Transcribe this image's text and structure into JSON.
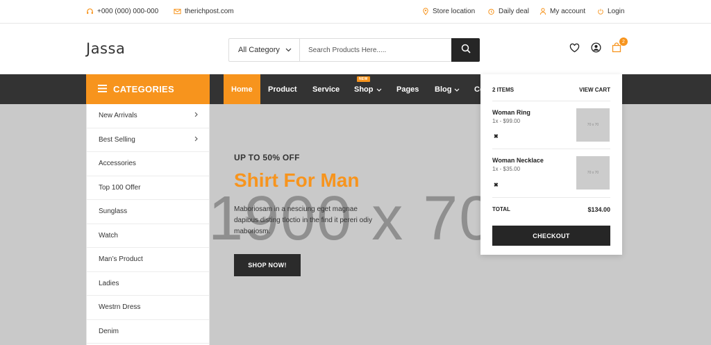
{
  "topbar": {
    "phone": "+000 (000) 000-000",
    "email": "therichpost.com",
    "store_location": "Store location",
    "daily_deal": "Daily deal",
    "my_account": "My account",
    "login": "Login"
  },
  "header": {
    "logo": "Jassa",
    "category_select": "All Category",
    "search_placeholder": "Search Products Here.....",
    "cart_count": "2"
  },
  "nav": {
    "categories_label": "CATEGORIES",
    "items": [
      {
        "label": "Home"
      },
      {
        "label": "Product"
      },
      {
        "label": "Service"
      },
      {
        "label": "Shop",
        "tag": "NEW"
      },
      {
        "label": "Pages"
      },
      {
        "label": "Blog"
      },
      {
        "label": "Co"
      }
    ]
  },
  "categories": [
    {
      "label": "New Arrivals"
    },
    {
      "label": "Best Selling"
    },
    {
      "label": "Accessories"
    },
    {
      "label": "Top 100 Offer"
    },
    {
      "label": "Sunglass"
    },
    {
      "label": "Watch"
    },
    {
      "label": "Man’s Product"
    },
    {
      "label": "Ladies"
    },
    {
      "label": "Westrn Dress"
    },
    {
      "label": "Denim"
    }
  ],
  "hero": {
    "placeholder": "1900 x 700",
    "eyebrow": "UP TO 50% OFF",
    "title": "Shirt For Man",
    "description": "Maboriosam in a nesciung eget magnae dapibus disting tloctio in the find it pereri odiy maboriosm.",
    "cta": "SHOP NOW!"
  },
  "cart": {
    "items_count": "2 ITEMS",
    "view_cart": "VIEW CART",
    "items": [
      {
        "name": "Woman Ring",
        "price": "1x - $99.00",
        "thumb": "70 x 70",
        "remove": "✖"
      },
      {
        "name": "Woman Necklace",
        "price": "1x - $35.00",
        "thumb": "70 x 70",
        "remove": "✖"
      }
    ],
    "total_label": "TOTAL",
    "total_value": "$134.00",
    "checkout": "CHECKOUT"
  },
  "colors": {
    "accent": "#f7941d",
    "dark": "#333333",
    "hero_bg": "#c9c9c9"
  },
  "icons": [
    "headphones-icon",
    "mail-icon",
    "location-pin-icon",
    "alarm-clock-icon",
    "user-icon",
    "power-icon",
    "chevron-down-icon",
    "search-icon",
    "heart-icon",
    "account-circle-icon",
    "shopping-bag-icon",
    "hamburger-icon",
    "chevron-right-icon",
    "close-icon"
  ]
}
